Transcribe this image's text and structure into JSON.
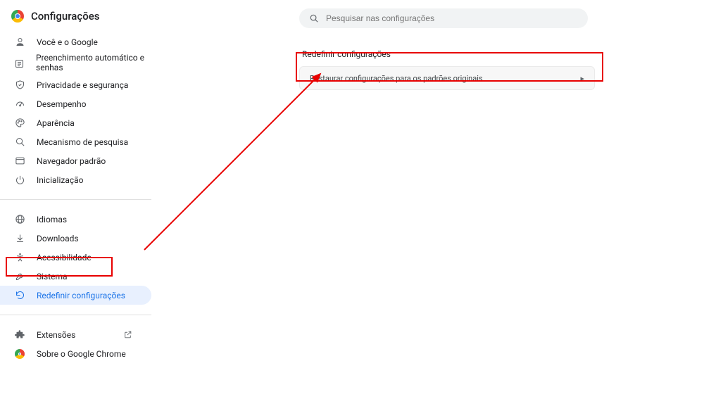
{
  "header": {
    "title": "Configurações"
  },
  "search": {
    "placeholder": "Pesquisar nas configurações"
  },
  "sidebar": {
    "items": [
      {
        "label": "Você e o Google",
        "icon": "person-icon"
      },
      {
        "label": "Preenchimento automático e senhas",
        "icon": "list-icon",
        "multiline": true
      },
      {
        "label": "Privacidade e segurança",
        "icon": "shield-icon"
      },
      {
        "label": "Desempenho",
        "icon": "speedometer-icon"
      },
      {
        "label": "Aparência",
        "icon": "palette-icon"
      },
      {
        "label": "Mecanismo de pesquisa",
        "icon": "search-icon"
      },
      {
        "label": "Navegador padrão",
        "icon": "window-icon"
      },
      {
        "label": "Inicialização",
        "icon": "power-icon"
      }
    ],
    "items2": [
      {
        "label": "Idiomas",
        "icon": "globe-icon"
      },
      {
        "label": "Downloads",
        "icon": "download-icon"
      },
      {
        "label": "Acessibilidade",
        "icon": "accessibility-icon"
      },
      {
        "label": "Sistema",
        "icon": "wrench-icon"
      },
      {
        "label": "Redefinir configurações",
        "icon": "restore-icon",
        "active": true
      }
    ],
    "items3": [
      {
        "label": "Extensões",
        "icon": "puzzle-icon",
        "external": true
      },
      {
        "label": "Sobre o Google Chrome",
        "icon": "chrome-icon"
      }
    ]
  },
  "main": {
    "section_title": "Redefinir configurações",
    "card_label": "Restaurar configurações para os padrões originais"
  },
  "colors": {
    "accent": "#1a73e8",
    "annotation": "#e80000"
  }
}
